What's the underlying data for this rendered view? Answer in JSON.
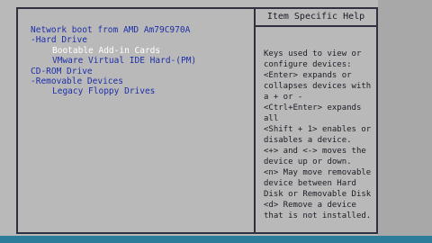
{
  "boot_list": {
    "items": [
      {
        "label": "Network boot from AMD Am79C970A",
        "indent": false,
        "selected": false
      },
      {
        "label": "-Hard Drive",
        "indent": false,
        "selected": false
      },
      {
        "label": "Bootable Add-in Cards",
        "indent": true,
        "selected": true
      },
      {
        "label": "VMware Virtual IDE Hard-(PM)",
        "indent": true,
        "selected": false
      },
      {
        "label": "CD-ROM Drive",
        "indent": false,
        "selected": false
      },
      {
        "label": "-Removable Devices",
        "indent": false,
        "selected": false
      },
      {
        "label": "Legacy Floppy Drives",
        "indent": true,
        "selected": false
      }
    ]
  },
  "help": {
    "title": "Item Specific Help",
    "text": "Keys used to view or\nconfigure devices:\n<Enter> expands or\ncollapses devices with\na + or -\n<Ctrl+Enter> expands\nall\n<Shift + 1> enables or\ndisables a device.\n<+> and <-> moves the\ndevice up or down.\n<n> May move removable\ndevice between Hard\nDisk or Removable Disk\n<d> Remove a device\nthat is not installed."
  },
  "colors": {
    "background": "#b9b9b9",
    "item_text": "#1e2fa8",
    "selected_text": "#ffffff",
    "bottom_bar": "#2d7d9a"
  }
}
